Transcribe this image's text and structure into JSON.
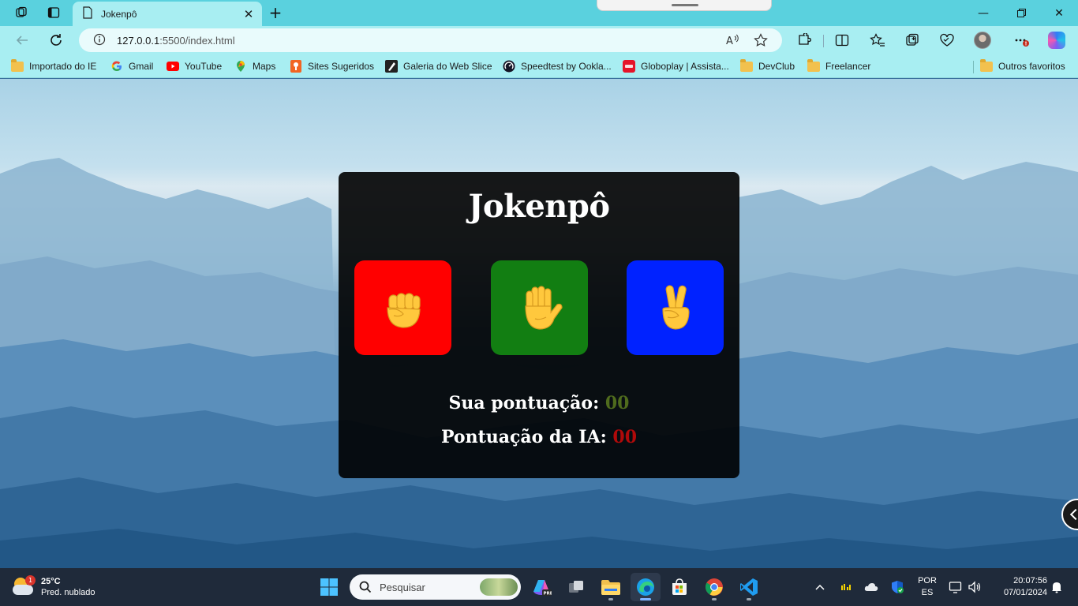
{
  "browser": {
    "tab_title": "Jokenpô",
    "url_host": "127.0.0.1",
    "url_path": ":5500/index.html"
  },
  "bookmarks": [
    {
      "label": "Importado do IE",
      "icon": "folder-icon"
    },
    {
      "label": "Gmail",
      "icon": "google-icon"
    },
    {
      "label": "YouTube",
      "icon": "youtube-icon"
    },
    {
      "label": "Maps",
      "icon": "maps-icon"
    },
    {
      "label": "Sites Sugeridos",
      "icon": "suggested-sites-icon"
    },
    {
      "label": "Galeria do Web Slice",
      "icon": "web-slice-icon"
    },
    {
      "label": "Speedtest by Ookla...",
      "icon": "speedtest-icon"
    },
    {
      "label": "Globoplay | Assista...",
      "icon": "globoplay-icon"
    },
    {
      "label": "DevClub",
      "icon": "folder-icon"
    },
    {
      "label": "Freelancer",
      "icon": "folder-icon"
    }
  ],
  "other_favorites": "Outros favoritos",
  "game": {
    "title": "Jokenpô",
    "choices": [
      {
        "name": "rock",
        "color": "#ff0000"
      },
      {
        "name": "paper",
        "color": "#127e12"
      },
      {
        "name": "scissors",
        "color": "#0022ff"
      }
    ],
    "player_score_label": "Sua pontuação:",
    "player_score": "00",
    "ai_score_label": "Pontuação da IA:",
    "ai_score": "00"
  },
  "taskbar": {
    "weather_badge": "1",
    "temperature": "25°C",
    "condition": "Pred. nublado",
    "search_placeholder": "Pesquisar",
    "lang_line1": "POR",
    "lang_line2": "ES",
    "time": "20:07:56",
    "date": "07/01/2024"
  }
}
